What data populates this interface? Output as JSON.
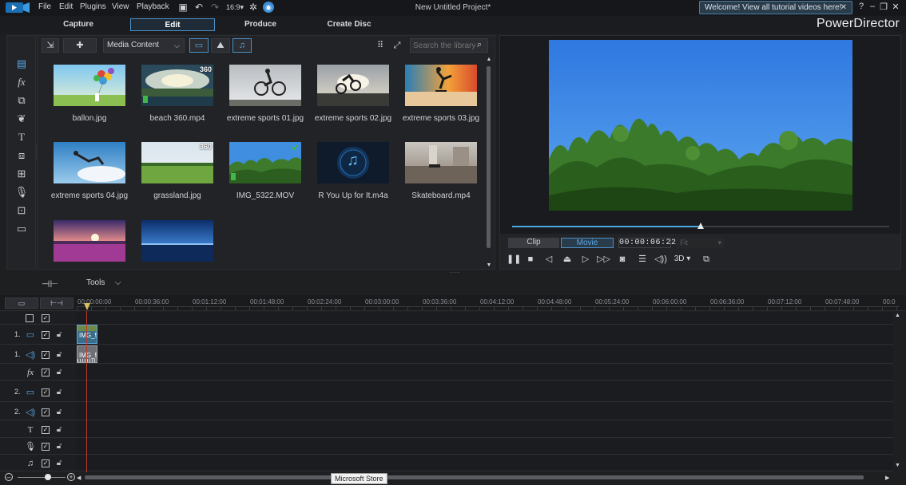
{
  "menubar": {
    "items": [
      "File",
      "Edit",
      "Plugins",
      "View",
      "Playback"
    ],
    "title": "New Untitled Project*",
    "welcome": "Welcome! View all tutorial videos here!",
    "help": "?"
  },
  "modes": {
    "tabs": [
      "Capture",
      "Edit",
      "Produce",
      "Create Disc"
    ],
    "active": "Edit",
    "brand": "PowerDirector"
  },
  "library": {
    "dropdown": "Media Content",
    "search_placeholder": "Search the library",
    "items": [
      {
        "label": "ballon.jpg",
        "badge": "",
        "type": "image"
      },
      {
        "label": "beach 360.mp4",
        "badge": "360",
        "type": "video"
      },
      {
        "label": "extreme sports 01.jpg",
        "badge": "",
        "type": "image"
      },
      {
        "label": "extreme sports 02.jpg",
        "badge": "",
        "type": "image"
      },
      {
        "label": "extreme sports 03.jpg",
        "badge": "",
        "type": "image"
      },
      {
        "label": "extreme sports 04.jpg",
        "badge": "",
        "type": "image"
      },
      {
        "label": "grassland.jpg",
        "badge": "360",
        "type": "image"
      },
      {
        "label": "IMG_5322.MOV",
        "badge": "",
        "type": "video",
        "checked": true
      },
      {
        "label": "R You Up for It.m4a",
        "badge": "",
        "type": "audio"
      },
      {
        "label": "Skateboard.mp4",
        "badge": "",
        "type": "video"
      },
      {
        "label": "",
        "badge": "",
        "type": "image"
      },
      {
        "label": "",
        "badge": "",
        "type": "image"
      }
    ]
  },
  "preview": {
    "clip_label": "Clip",
    "movie_label": "Movie",
    "timecode": "00:00:06:22",
    "fit": "Fit",
    "progress": 0.5,
    "threed": "3D"
  },
  "timeline": {
    "tools_label": "Tools",
    "ticks": [
      "00:00:00:00",
      "00:00:36:00",
      "00:01:12:00",
      "00:01:48:00",
      "00:02:24:00",
      "00:03:00:00",
      "00:03:36:00",
      "00:04:12:00",
      "00:04:48:00",
      "00:05:24:00",
      "00:06:00:00",
      "00:06:36:00",
      "00:07:12:00",
      "00:07:48:00",
      "00:0"
    ],
    "tracks": [
      "1.",
      "1.",
      "",
      "2.",
      "2.",
      "",
      "",
      ""
    ],
    "clip_video": "IMG_5",
    "clip_audio": "IMG_5"
  },
  "taskbar_tooltip": "Microsoft Store"
}
